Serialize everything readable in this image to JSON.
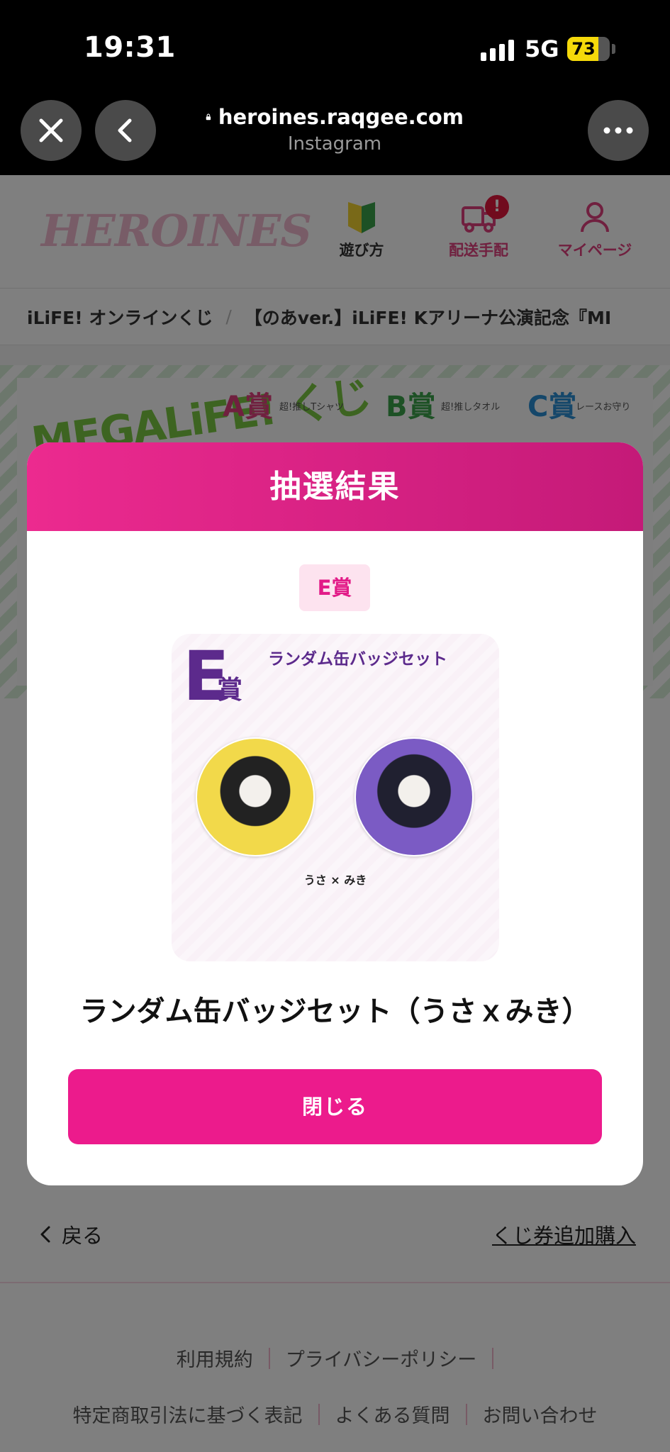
{
  "status_bar": {
    "time": "19:31",
    "network": "5G",
    "battery_percent": "73",
    "battery_level": 0.73
  },
  "browser": {
    "url": "heroines.raqgee.com",
    "source": "Instagram",
    "icons": [
      "close-icon",
      "back-icon",
      "lock-icon",
      "more-icon"
    ]
  },
  "header": {
    "logo": "HEROINES",
    "nav": [
      {
        "label": "遊び方",
        "icon": "beginner-mark-icon",
        "color": "#333333"
      },
      {
        "label": "配送手配",
        "icon": "truck-icon",
        "badge": "!",
        "color": "#e0407f"
      },
      {
        "label": "マイページ",
        "icon": "user-icon",
        "color": "#e0407f"
      }
    ]
  },
  "breadcrumb": {
    "items": [
      "iLiFE! オンラインくじ",
      "【のあver.】iLiFE! Kアリーナ公演記念『MI"
    ],
    "separator": "/"
  },
  "banner": {
    "title": "MEGALiFE! くじ",
    "prizes": [
      {
        "rank": "A賞",
        "desc": "超!推しTシャツ"
      },
      {
        "rank": "B賞",
        "desc": "超!推しタオル"
      },
      {
        "rank": "C賞",
        "desc": "レースお守り"
      }
    ]
  },
  "modal": {
    "title": "抽選結果",
    "rank": "E賞",
    "card": {
      "rank_letter": "E",
      "rank_suffix": "賞",
      "title": "ランダム缶バッジセット",
      "names": "うさ × みき"
    },
    "prize_name": "ランダム缶バッジセット（うさｘみき）",
    "close_label": "閉じる"
  },
  "page": {
    "back_label": "戻る",
    "buy_more_label": "くじ券追加購入"
  },
  "footer": {
    "row1": [
      "利用規約",
      "プライバシーポリシー"
    ],
    "row2": [
      "特定商取引法に基づく表記",
      "よくある質問",
      "お問い合わせ"
    ]
  },
  "colors": {
    "brand_pink": "#ec1b8c",
    "modal_gradient_start": "#ec2a8f",
    "modal_gradient_end": "#c41a78",
    "card_purple": "#5c2a8c"
  }
}
